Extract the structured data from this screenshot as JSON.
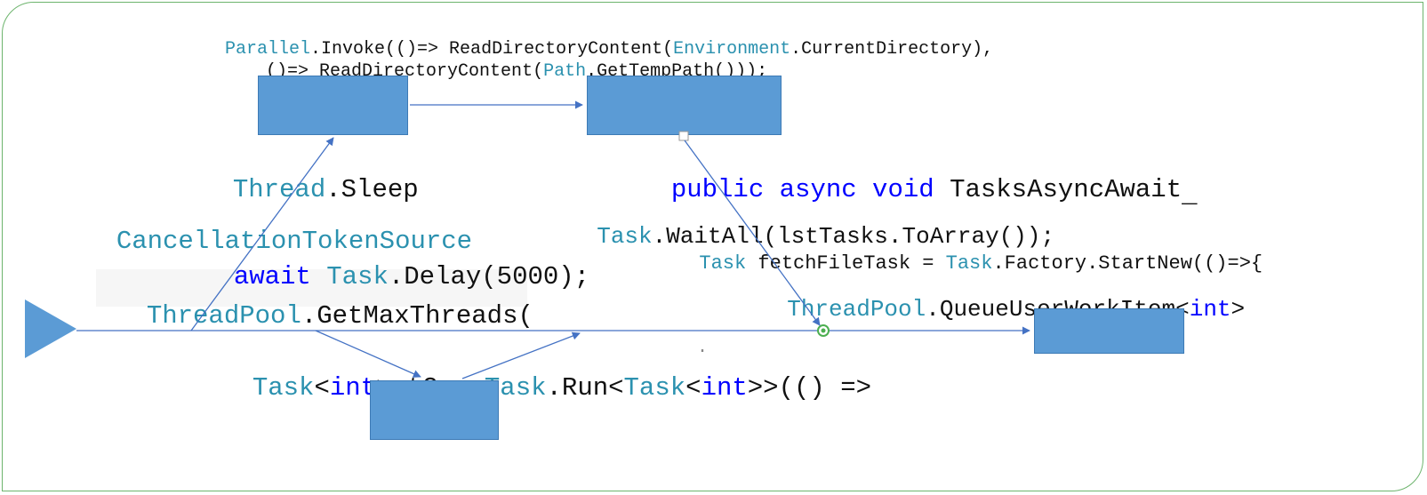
{
  "colors": {
    "border": "#6db46d",
    "block": "#5b9bd5",
    "arrow": "#4472c4",
    "triangle_fill": "#5b9bd5"
  },
  "code": {
    "line1_a": "Parallel",
    "line1_b": ".Invoke(()=> ReadDirectoryContent(",
    "line1_c": "Environment",
    "line1_d": ".CurrentDirectory),",
    "line2_a": "()=> ReadDirectoryContent(",
    "line2_b": "Path",
    "line2_c": ".GetTempPath()));",
    "threadSleep_a": "Thread",
    "threadSleep_b": ".Sleep",
    "publicAsync_a": "public",
    "publicAsync_b": " async",
    "publicAsync_c": " void",
    "publicAsync_d": " TasksAsyncAwait",
    "publicAsync_cursor": "_",
    "cts": "CancellationTokenSource",
    "waitAll_a": "Task",
    "waitAll_b": ".WaitAll(lstTasks.ToArray());",
    "awaitDelay_a": "await",
    "awaitDelay_b": " Task",
    "awaitDelay_c": ".Delay(",
    "awaitDelay_num": "5000",
    "awaitDelay_d": ");",
    "fetchFile_a": "Task",
    "fetchFile_b": " fetchFileTask = ",
    "fetchFile_c": "Task",
    "fetchFile_d": ".Factory.StartNew(()=>{",
    "tp1_a": "ThreadPool",
    "tp1_b": ".GetMaxThreads(",
    "tp2_a": "ThreadPool",
    "tp2_b": ".QueueUserWorkItem",
    "tp2_c": "<",
    "tp2_d": "int",
    "tp2_e": ">",
    "taskRun_a": "Task",
    "taskRun_b": "<",
    "taskRun_c": "int",
    "taskRun_d": "> t2 = ",
    "taskRun_e": "Task",
    "taskRun_f": ".Run<",
    "taskRun_g": "Task",
    "taskRun_h": "<",
    "taskRun_i": "int",
    "taskRun_j": ">>(() =>",
    "dot_small": "."
  }
}
